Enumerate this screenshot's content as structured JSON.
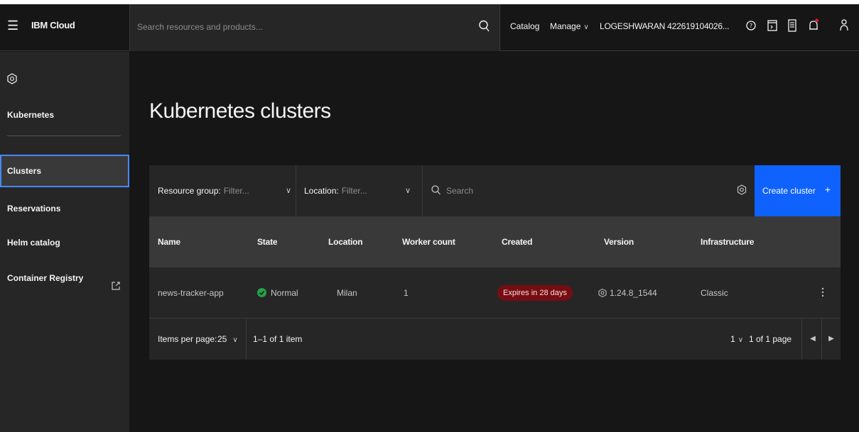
{
  "header": {
    "brand": "IBM Cloud",
    "search_placeholder": "Search resources and products...",
    "catalog": "Catalog",
    "manage": "Manage",
    "account": "LOGESHWARAN 422619104026..."
  },
  "sidebar": {
    "title": "Kubernetes",
    "items": [
      {
        "label": "Clusters"
      },
      {
        "label": "Reservations"
      },
      {
        "label": "Helm catalog"
      },
      {
        "label": "Container Registry"
      }
    ]
  },
  "main": {
    "title": "Kubernetes clusters"
  },
  "toolbar": {
    "resource_group_label": "Resource group:",
    "resource_group_placeholder": "Filter...",
    "location_label": "Location:",
    "location_placeholder": "Filter...",
    "search_placeholder": "Search",
    "create_label": "Create cluster",
    "create_plus": "+"
  },
  "table": {
    "columns": [
      "Name",
      "State",
      "Location",
      "Worker count",
      "Created",
      "Version",
      "Infrastructure"
    ],
    "rows": [
      {
        "name": "news-tracker-app",
        "state": "Normal",
        "location": "Milan",
        "worker_count": "1",
        "created": "Expires in 28 days",
        "version": "1.24.8_1544",
        "infrastructure": "Classic"
      }
    ]
  },
  "pagination": {
    "items_per_page_label": "Items per page:",
    "items_per_page": "25",
    "range": "1–1 of 1 item",
    "page": "1",
    "page_of": "1 of 1 page"
  },
  "colors": {
    "accent": "#0f62fe",
    "focus": "#4589ff",
    "status_ok": "#24a148",
    "badge_bg": "#750e13",
    "notification": "#da1e28"
  }
}
